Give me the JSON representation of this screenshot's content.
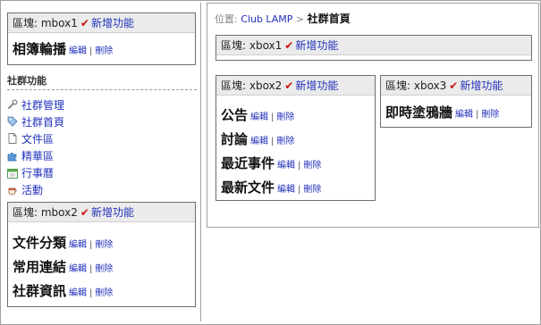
{
  "left": {
    "mbox1": {
      "label": "區塊: mbox1",
      "add": "新增功能",
      "items": [
        {
          "title": "相簿輪播",
          "edit": "編輯",
          "sep": "|",
          "del": "刪除"
        }
      ]
    },
    "section_title": "社群功能",
    "nav": [
      {
        "label": "社群管理",
        "icon": "wrench-icon"
      },
      {
        "label": "社群首頁",
        "icon": "tag-icon"
      },
      {
        "label": "文件區",
        "icon": "document-icon"
      },
      {
        "label": "精華區",
        "icon": "puzzle-icon"
      },
      {
        "label": "行事曆",
        "icon": "calendar-icon"
      },
      {
        "label": "活動",
        "icon": "coffee-cup-icon"
      }
    ],
    "mbox2": {
      "label": "區塊: mbox2",
      "add": "新增功能",
      "items": [
        {
          "title": "文件分類",
          "edit": "編輯",
          "sep": "|",
          "del": "刪除"
        },
        {
          "title": "常用連結",
          "edit": "編輯",
          "sep": "|",
          "del": "刪除"
        },
        {
          "title": "社群資訊",
          "edit": "編輯",
          "sep": "|",
          "del": "刪除"
        }
      ]
    }
  },
  "breadcrumb": {
    "prefix": "位置:",
    "link": "Club LAMP",
    "sep": ">",
    "current": "社群首頁"
  },
  "xbox1": {
    "label": "區塊: xbox1",
    "add": "新增功能"
  },
  "xbox2": {
    "label": "區塊: xbox2",
    "add": "新增功能",
    "items": [
      {
        "title": "公告",
        "edit": "編輯",
        "sep": "|",
        "del": "刪除"
      },
      {
        "title": "討論",
        "edit": "編輯",
        "sep": "|",
        "del": "刪除"
      },
      {
        "title": "最近事件",
        "edit": "編輯",
        "sep": "|",
        "del": "刪除"
      },
      {
        "title": "最新文件",
        "edit": "編輯",
        "sep": "|",
        "del": "刪除"
      }
    ]
  },
  "xbox3": {
    "label": "區塊: xbox3",
    "add": "新增功能",
    "items": [
      {
        "title": "即時塗鴉牆",
        "edit": "編輯",
        "sep": "|",
        "del": "刪除"
      }
    ]
  },
  "colors": {
    "link": "#2233bb",
    "check": "#cc1111",
    "box_header": "#ebebeb"
  }
}
